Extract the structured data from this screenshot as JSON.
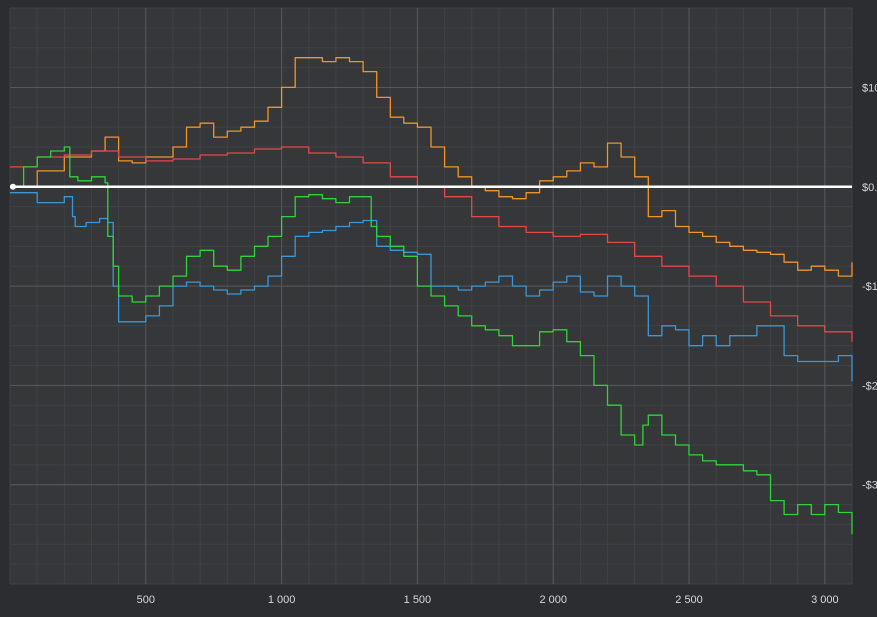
{
  "chart_data": {
    "type": "line",
    "title": "",
    "xlabel": "",
    "ylabel": "",
    "xlim": [
      0,
      3100
    ],
    "ylim": [
      -20,
      9
    ],
    "x_ticks": [
      {
        "value": 500,
        "label": "500"
      },
      {
        "value": 1000,
        "label": "1 000"
      },
      {
        "value": 1500,
        "label": "1 500"
      },
      {
        "value": 2000,
        "label": "2 000"
      },
      {
        "value": 2500,
        "label": "2 500"
      },
      {
        "value": 3000,
        "label": "3 000"
      }
    ],
    "y_ticks": [
      {
        "value": 5,
        "label": "$10"
      },
      {
        "value": 0,
        "label": "$0."
      },
      {
        "value": -5,
        "label": "-$1"
      },
      {
        "value": -10,
        "label": "-$2"
      },
      {
        "value": -15,
        "label": "-$3"
      }
    ],
    "grid": true,
    "legend": "none",
    "baseline": {
      "value": 0,
      "color": "#ffffff"
    },
    "series": [
      {
        "color": "#f0942b",
        "x": [
          0,
          100,
          200,
          300,
          350,
          400,
          450,
          500,
          550,
          600,
          650,
          700,
          750,
          800,
          850,
          900,
          950,
          1000,
          1050,
          1100,
          1150,
          1200,
          1250,
          1300,
          1350,
          1400,
          1450,
          1500,
          1550,
          1600,
          1650,
          1700,
          1750,
          1800,
          1850,
          1900,
          1950,
          2000,
          2050,
          2100,
          2150,
          2200,
          2250,
          2300,
          2350,
          2400,
          2450,
          2500,
          2550,
          2600,
          2650,
          2700,
          2750,
          2800,
          2850,
          2900,
          2950,
          3000,
          3050,
          3100
        ],
        "y": [
          0.0,
          0.8,
          1.5,
          1.8,
          2.5,
          1.3,
          1.2,
          1.5,
          1.5,
          2.0,
          3.0,
          3.2,
          2.5,
          2.8,
          3.0,
          3.3,
          4.0,
          5.0,
          6.5,
          6.5,
          6.3,
          6.5,
          6.3,
          5.8,
          4.5,
          3.5,
          3.2,
          3.0,
          2.0,
          1.0,
          0.5,
          0.0,
          -0.2,
          -0.5,
          -0.6,
          -0.3,
          0.3,
          0.5,
          0.8,
          1.2,
          1.0,
          2.2,
          1.5,
          0.5,
          -1.5,
          -1.2,
          -2.0,
          -2.3,
          -2.5,
          -2.8,
          -3.0,
          -3.2,
          -3.3,
          -3.4,
          -3.8,
          -4.2,
          -4.0,
          -4.2,
          -4.5,
          -3.8
        ]
      },
      {
        "color": "#e4484d",
        "x": [
          0,
          100,
          200,
          300,
          400,
          500,
          600,
          700,
          800,
          900,
          1000,
          1100,
          1200,
          1300,
          1400,
          1500,
          1600,
          1700,
          1800,
          1900,
          2000,
          2100,
          2200,
          2300,
          2400,
          2500,
          2600,
          2700,
          2800,
          2900,
          3000,
          3100
        ],
        "y": [
          1.0,
          1.5,
          1.6,
          1.8,
          1.5,
          1.3,
          1.4,
          1.6,
          1.7,
          1.9,
          2.0,
          1.7,
          1.5,
          1.2,
          0.5,
          0.0,
          -0.5,
          -1.5,
          -2.0,
          -2.3,
          -2.5,
          -2.4,
          -2.8,
          -3.5,
          -4.0,
          -4.5,
          -5.0,
          -5.8,
          -6.5,
          -7.0,
          -7.3,
          -7.8
        ]
      },
      {
        "color": "#3d97d6",
        "x": [
          0,
          100,
          200,
          230,
          240,
          280,
          330,
          360,
          380,
          400,
          450,
          500,
          550,
          600,
          650,
          700,
          750,
          800,
          850,
          900,
          950,
          1000,
          1050,
          1100,
          1150,
          1200,
          1250,
          1300,
          1350,
          1400,
          1450,
          1500,
          1550,
          1600,
          1650,
          1700,
          1750,
          1800,
          1850,
          1900,
          1950,
          2000,
          2050,
          2100,
          2150,
          2200,
          2250,
          2300,
          2350,
          2400,
          2450,
          2500,
          2550,
          2600,
          2650,
          2700,
          2750,
          2800,
          2850,
          2900,
          2950,
          3000,
          3050,
          3100
        ],
        "y": [
          -0.3,
          -0.8,
          -0.5,
          -1.5,
          -2.0,
          -1.8,
          -1.6,
          -1.8,
          -5.0,
          -6.8,
          -6.8,
          -6.5,
          -6.0,
          -5.0,
          -4.8,
          -5.0,
          -5.2,
          -5.4,
          -5.2,
          -5.0,
          -4.5,
          -3.5,
          -2.5,
          -2.3,
          -2.2,
          -2.0,
          -1.8,
          -1.7,
          -3.0,
          -3.2,
          -3.3,
          -3.4,
          -5.0,
          -5.0,
          -5.2,
          -5.0,
          -4.8,
          -4.5,
          -5.0,
          -5.5,
          -5.2,
          -4.8,
          -4.5,
          -5.3,
          -5.5,
          -4.5,
          -5.0,
          -5.5,
          -7.5,
          -7.0,
          -7.2,
          -8.0,
          -7.5,
          -8.0,
          -7.5,
          -7.5,
          -7.0,
          -7.0,
          -8.5,
          -8.8,
          -8.8,
          -8.8,
          -8.5,
          -9.8
        ]
      },
      {
        "color": "#31d33b",
        "x": [
          0,
          50,
          100,
          150,
          200,
          220,
          250,
          300,
          350,
          360,
          380,
          400,
          450,
          500,
          550,
          600,
          650,
          700,
          750,
          800,
          850,
          900,
          950,
          1000,
          1050,
          1100,
          1150,
          1200,
          1250,
          1300,
          1330,
          1350,
          1400,
          1450,
          1500,
          1550,
          1600,
          1650,
          1700,
          1750,
          1800,
          1850,
          1900,
          1950,
          2000,
          2050,
          2100,
          2150,
          2200,
          2250,
          2300,
          2330,
          2350,
          2400,
          2450,
          2500,
          2550,
          2600,
          2650,
          2700,
          2750,
          2800,
          2850,
          2900,
          2950,
          3000,
          3050,
          3100
        ],
        "y": [
          0.0,
          1.0,
          1.5,
          1.8,
          2.0,
          0.5,
          0.3,
          0.5,
          0.2,
          -2.5,
          -4.0,
          -5.5,
          -5.8,
          -5.5,
          -5.0,
          -4.5,
          -3.5,
          -3.2,
          -4.0,
          -4.2,
          -3.5,
          -3.0,
          -2.5,
          -1.5,
          -0.5,
          -0.4,
          -0.6,
          -0.8,
          -0.5,
          -0.5,
          -2.0,
          -2.5,
          -3.0,
          -3.5,
          -5.0,
          -5.5,
          -6.0,
          -6.5,
          -7.0,
          -7.2,
          -7.5,
          -8.0,
          -8.0,
          -7.3,
          -7.2,
          -7.8,
          -8.5,
          -10.0,
          -11.0,
          -12.5,
          -13.0,
          -12.0,
          -11.5,
          -12.5,
          -13.0,
          -13.5,
          -13.8,
          -14.0,
          -14.0,
          -14.3,
          -14.5,
          -15.8,
          -16.5,
          -16.0,
          -16.5,
          -16.0,
          -16.4,
          -17.5
        ]
      }
    ]
  }
}
